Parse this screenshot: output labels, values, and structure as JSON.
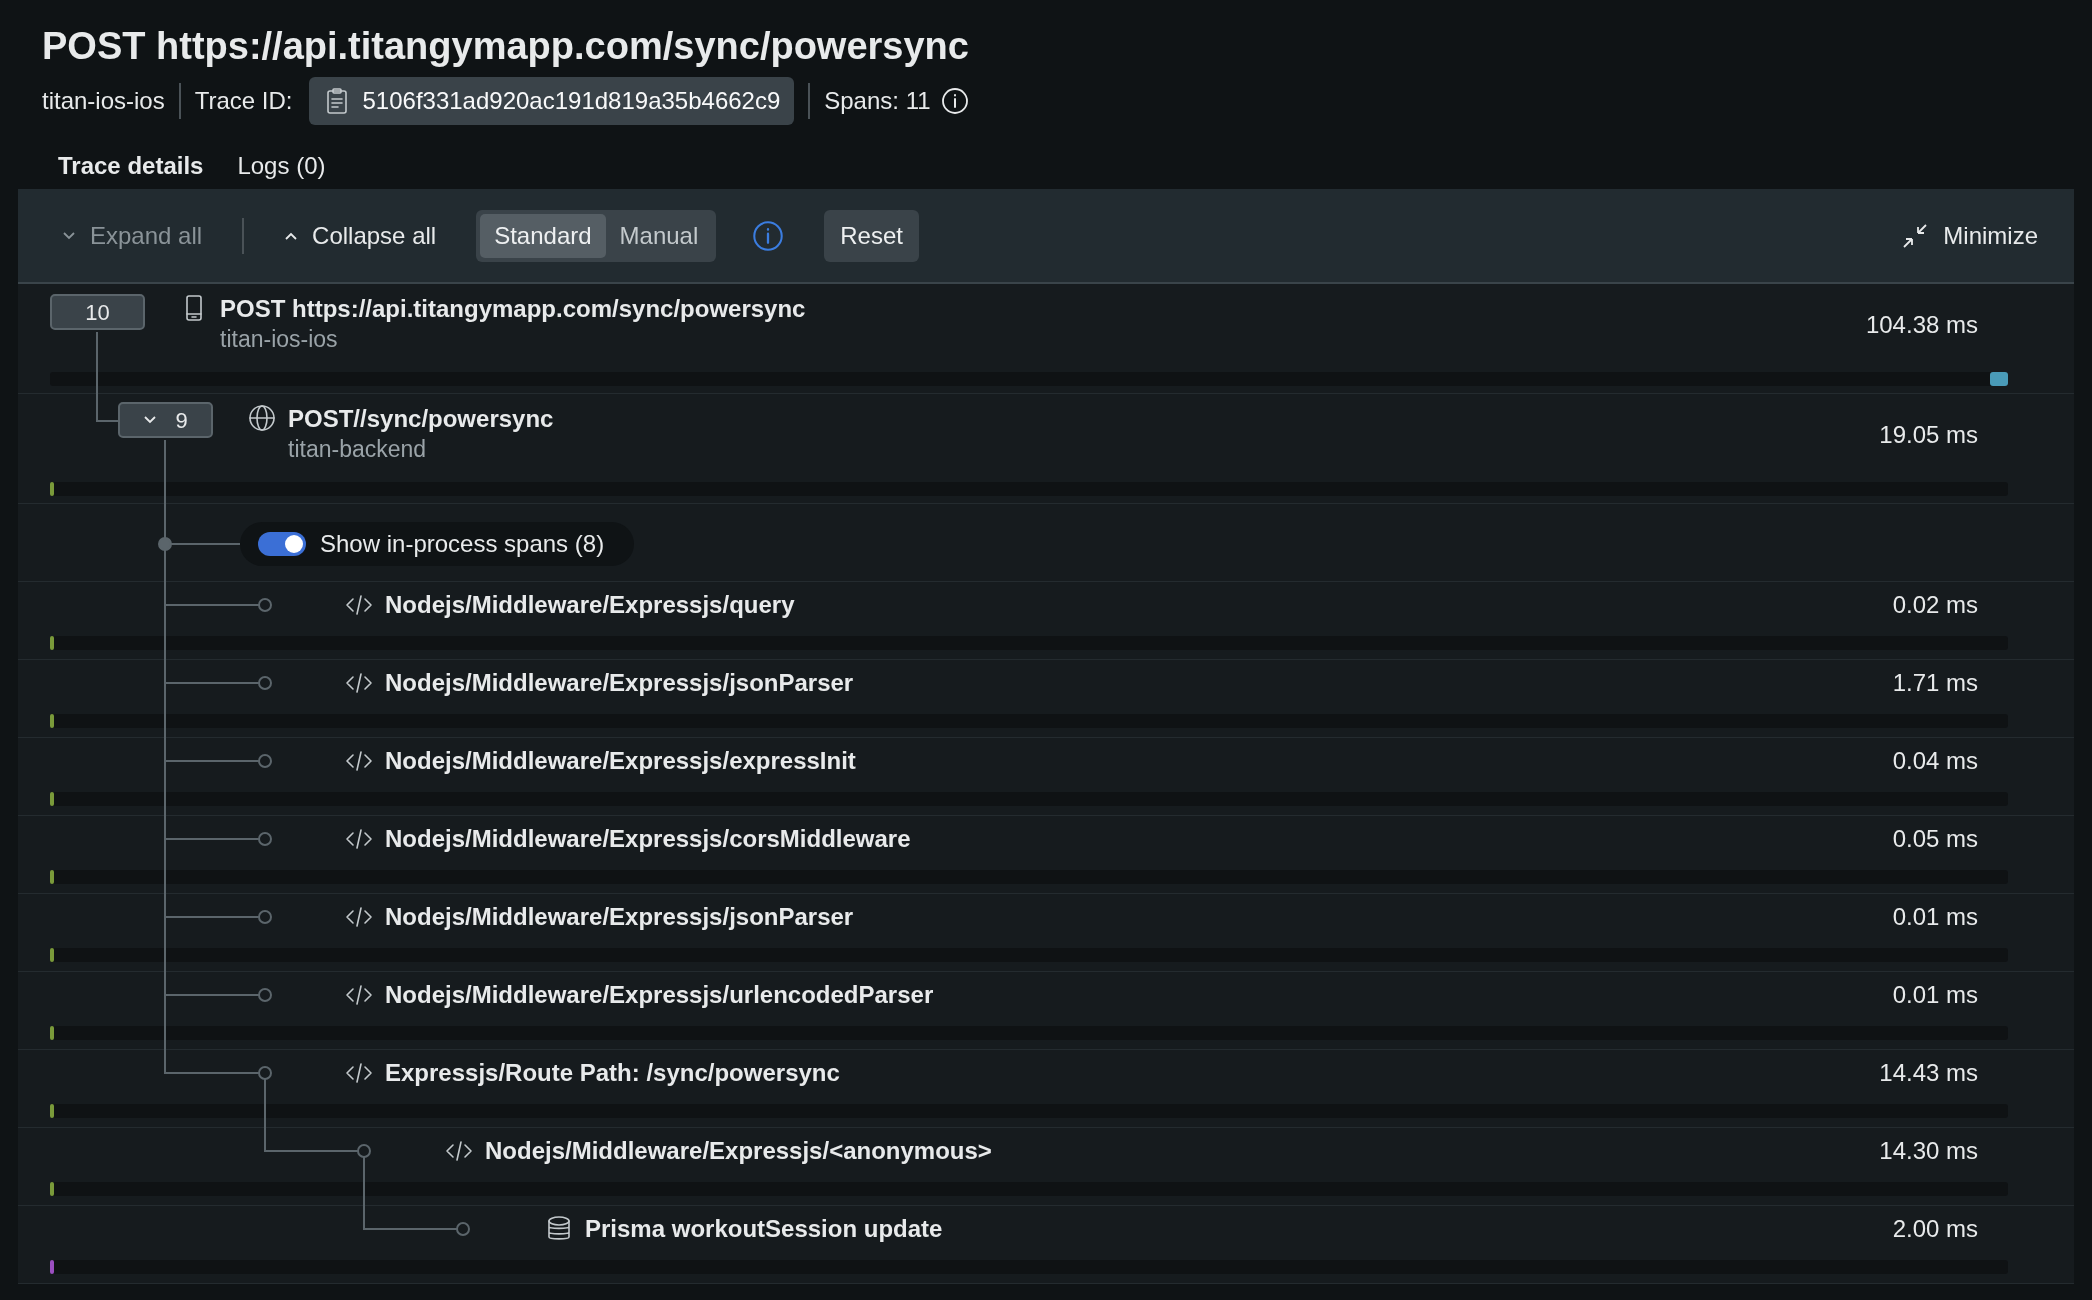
{
  "title": "POST https://api.titangymapp.com/sync/powersync",
  "meta": {
    "service": "titan-ios-ios",
    "trace_id_label": "Trace ID:",
    "trace_id": "5106f331ad920ac191d819a35b4662c9",
    "spans": "Spans: 11"
  },
  "tabs": [
    {
      "label": "Trace details",
      "selected": true
    },
    {
      "label": "Logs (0)",
      "selected": false
    }
  ],
  "toolbar": {
    "expand_all": {
      "label": "Expand all",
      "disabled": true
    },
    "collapse_all": {
      "label": "Collapse all",
      "disabled": false
    },
    "modes": [
      {
        "label": "Standard",
        "selected": true
      },
      {
        "label": "Manual",
        "selected": false
      }
    ],
    "reset": "Reset",
    "minimize": "Minimize"
  },
  "spans": [
    {
      "kind": "mobile",
      "name": "POST https://api.titangymapp.com/sync/powersync",
      "service": "titan-ios-ios",
      "badge": "10",
      "chevron": false,
      "duration": "104.38 ms",
      "color": "#4a9bb8",
      "bar_at_end": true,
      "children": [
        {
          "kind": "globe",
          "name": "POST//sync/powersync",
          "service": "titan-backend",
          "badge": "9",
          "chevron": true,
          "duration": "19.05 ms",
          "color": "#7a9a3a",
          "bar_at_end": false,
          "in_process": {
            "label": "Show in-process spans (8)",
            "on": true,
            "spans": [
              {
                "kind": "code",
                "name": "Nodejs/Middleware/Expressjs/query",
                "duration": "0.02 ms",
                "color": "#7a9a3a",
                "bar_at_end": false
              },
              {
                "kind": "code",
                "name": "Nodejs/Middleware/Expressjs/jsonParser",
                "duration": "1.71 ms",
                "color": "#7a9a3a",
                "bar_at_end": false
              },
              {
                "kind": "code",
                "name": "Nodejs/Middleware/Expressjs/expressInit",
                "duration": "0.04 ms",
                "color": "#7a9a3a",
                "bar_at_end": false
              },
              {
                "kind": "code",
                "name": "Nodejs/Middleware/Expressjs/corsMiddleware",
                "duration": "0.05 ms",
                "color": "#7a9a3a",
                "bar_at_end": false
              },
              {
                "kind": "code",
                "name": "Nodejs/Middleware/Expressjs/jsonParser",
                "duration": "0.01 ms",
                "color": "#7a9a3a",
                "bar_at_end": false
              },
              {
                "kind": "code",
                "name": "Nodejs/Middleware/Expressjs/urlencodedParser",
                "duration": "0.01 ms",
                "color": "#7a9a3a",
                "bar_at_end": false
              },
              {
                "kind": "code",
                "name": "Expressjs/Route Path: /sync/powersync",
                "duration": "14.43 ms",
                "color": "#7a9a3a",
                "bar_at_end": false,
                "children": [
                  {
                    "kind": "code",
                    "name": "Nodejs/Middleware/Expressjs/<anonymous>",
                    "duration": "14.30 ms",
                    "color": "#7a9a3a",
                    "bar_at_end": false,
                    "children": [
                      {
                        "kind": "database",
                        "name": "Prisma workoutSession update",
                        "duration": "2.00 ms",
                        "color": "#9b4fc0",
                        "bar_at_end": false
                      }
                    ]
                  }
                ]
              }
            ]
          }
        }
      ]
    }
  ]
}
